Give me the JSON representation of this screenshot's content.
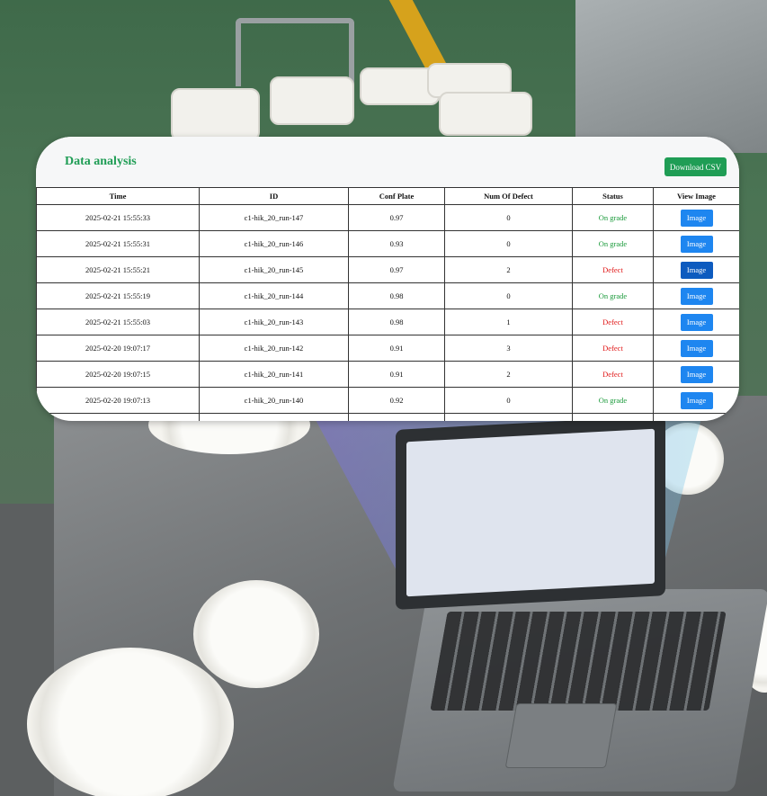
{
  "panel": {
    "title": "Data analysis",
    "download_label": "Download CSV"
  },
  "table": {
    "headers": [
      "Time",
      "ID",
      "Conf Plate",
      "Num Of Defect",
      "Status",
      "View Image"
    ],
    "rows": [
      {
        "time": "2025-02-21 15:55:33",
        "id": "c1-hik_20_run-147",
        "conf": "0.97",
        "defects": "0",
        "status": "On grade",
        "button": "Image"
      },
      {
        "time": "2025-02-21 15:55:31",
        "id": "c1-hik_20_run-146",
        "conf": "0.93",
        "defects": "0",
        "status": "On grade",
        "button": "Image"
      },
      {
        "time": "2025-02-21 15:55:21",
        "id": "c1-hik_20_run-145",
        "conf": "0.97",
        "defects": "2",
        "status": "Defect",
        "button": "Image"
      },
      {
        "time": "2025-02-21 15:55:19",
        "id": "c1-hik_20_run-144",
        "conf": "0.98",
        "defects": "0",
        "status": "On grade",
        "button": "Image"
      },
      {
        "time": "2025-02-21 15:55:03",
        "id": "c1-hik_20_run-143",
        "conf": "0.98",
        "defects": "1",
        "status": "Defect",
        "button": "Image"
      },
      {
        "time": "2025-02-20 19:07:17",
        "id": "c1-hik_20_run-142",
        "conf": "0.91",
        "defects": "3",
        "status": "Defect",
        "button": "Image"
      },
      {
        "time": "2025-02-20 19:07:15",
        "id": "c1-hik_20_run-141",
        "conf": "0.91",
        "defects": "2",
        "status": "Defect",
        "button": "Image"
      },
      {
        "time": "2025-02-20 19:07:13",
        "id": "c1-hik_20_run-140",
        "conf": "0.92",
        "defects": "0",
        "status": "On grade",
        "button": "Image"
      }
    ]
  },
  "colors": {
    "accent_green": "#1f9d55",
    "status_ok": "#1a9a3a",
    "status_defect": "#e01818",
    "button_blue": "#1e86f0",
    "button_blue_active": "#0d5bbf"
  }
}
